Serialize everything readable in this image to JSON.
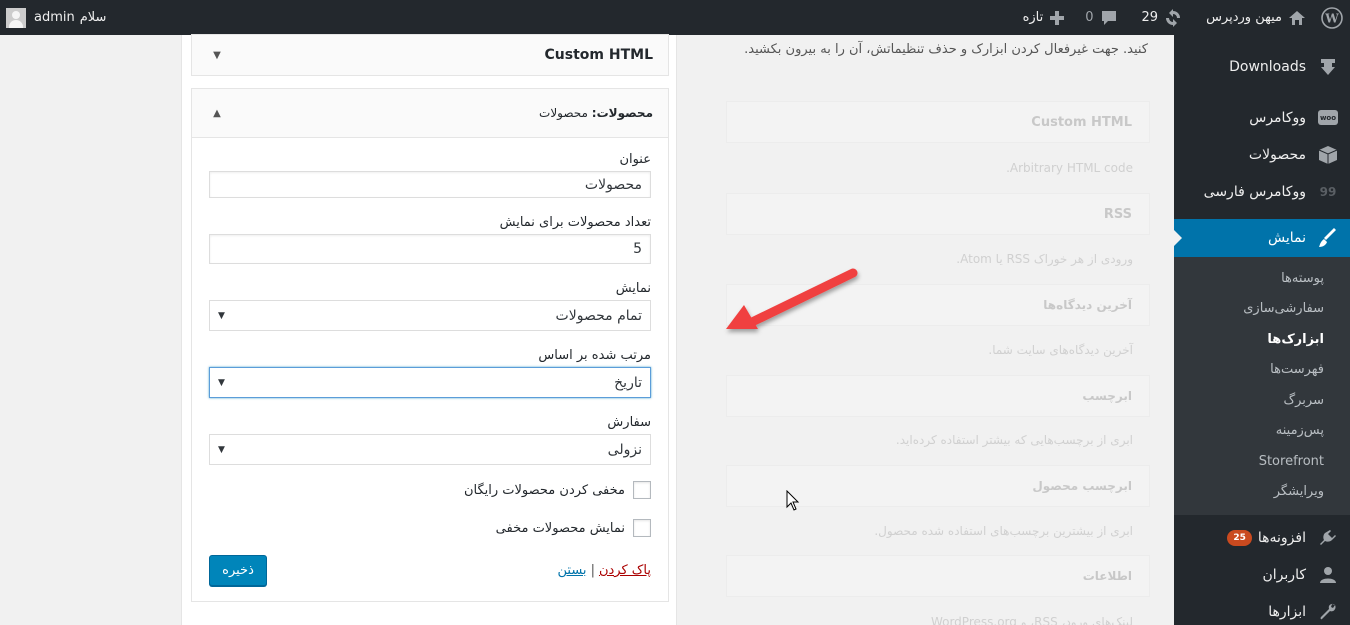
{
  "adminbar": {
    "site_name": "میهن وردپرس",
    "updates_count": "29",
    "comments_count": "0",
    "new_label": "تازه",
    "greeting": "سلام",
    "username": "admin"
  },
  "sidebar": {
    "items": [
      {
        "label": "Downloads",
        "icon": "download-icon"
      },
      {
        "label": "ووکامرس",
        "icon": "woocommerce-icon"
      },
      {
        "label": "محصولات",
        "icon": "box-icon"
      },
      {
        "label": "ووکامرس فارسی",
        "icon": "quote-icon"
      },
      {
        "label": "نمایش",
        "icon": "paintbrush-icon",
        "current": true
      }
    ],
    "submenu": [
      {
        "label": "پوسته‌ها"
      },
      {
        "label": "سفارشی‌سازی"
      },
      {
        "label": "ابزارک‌ها",
        "current": true
      },
      {
        "label": "فهرست‌ها"
      },
      {
        "label": "سربرگ"
      },
      {
        "label": "پس‌زمینه"
      },
      {
        "label": "Storefront"
      },
      {
        "label": "ویرایشگر"
      }
    ],
    "items_after": [
      {
        "label": "افزونه‌ها",
        "icon": "plugin-icon",
        "badge": "25"
      },
      {
        "label": "کاربران",
        "icon": "user-icon"
      },
      {
        "label": "ابزارها",
        "icon": "wrench-icon"
      }
    ]
  },
  "widgets_area": {
    "custom_html_title": "Custom HTML",
    "products_widget": {
      "title_prefix": "محصولات:",
      "title_value": "محصولات",
      "fields": {
        "title_label": "عنوان",
        "title_value": "محصولات",
        "number_label": "تعداد محصولات برای نمایش",
        "number_value": "5",
        "show_label": "نمایش",
        "show_value": "تمام محصولات",
        "orderby_label": "مرتب شده بر اساس",
        "orderby_value": "تاریخ",
        "order_label": "سفارش",
        "order_value": "نزولی",
        "hide_free_label": "مخفی کردن محصولات رایگان",
        "hide_free_checked": false,
        "show_hidden_label": "نمایش محصولات مخفی",
        "show_hidden_checked": false
      },
      "delete_label": "پاک کردن",
      "close_label": "بستن",
      "save_label": "ذخیره"
    }
  },
  "available_widgets": {
    "intro_text": "کنید. جهت غیرفعال کردن ابزارک و حذف تنظیماتش، آن را به بیرون بکشید.",
    "items": [
      {
        "title": "Custom HTML",
        "desc": "Arbitrary HTML code."
      },
      {
        "title": "RSS",
        "desc": "ورودی از هر خوراک RSS یا Atom."
      },
      {
        "title": "آخرین دیدگاه‌ها",
        "desc": "آخرین دیدگاه‌های سایت شما."
      },
      {
        "title": "ابرچسب",
        "desc": "ابری از برچسب‌هایی که بیشتر استفاده کرده‌اید."
      },
      {
        "title": "ابرچسب محصول",
        "desc": "ابری از بیشترین برچسب‌های استفاده شده محصول."
      },
      {
        "title": "اطلاعات",
        "desc": "لینک‌های ورود، RSS، و WordPress.org"
      }
    ]
  },
  "colors": {
    "admin_dark": "#23282d",
    "accent_blue": "#0073aa",
    "button_blue": "#0085ba",
    "badge_orange": "#ca4a1f",
    "delete_red": "#a00",
    "arrow_red": "#f0403f"
  }
}
